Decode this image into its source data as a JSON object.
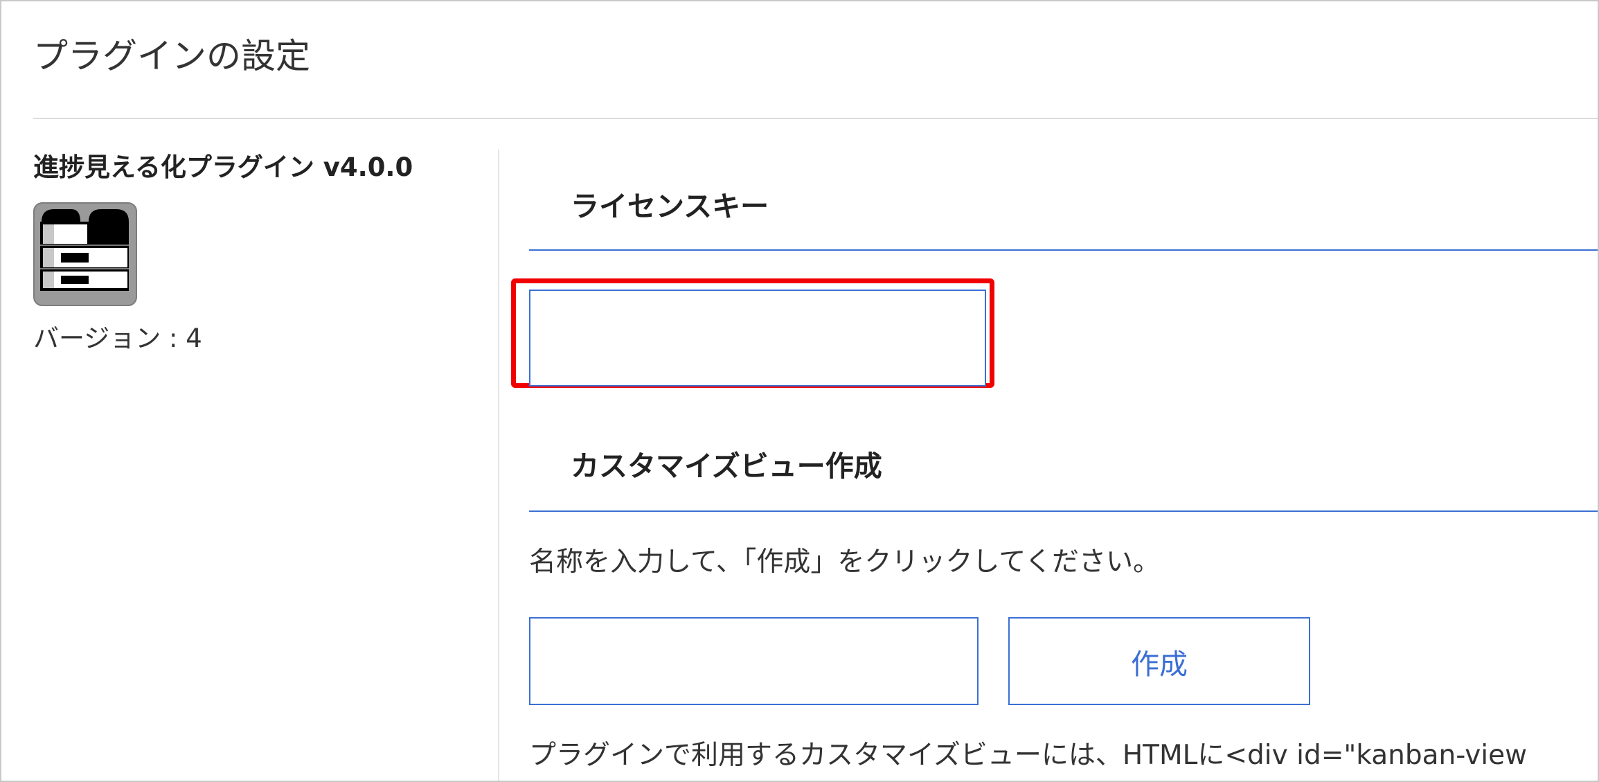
{
  "page": {
    "title": "プラグインの設定"
  },
  "plugin": {
    "name": "進捗見える化プラグイン v4.0.0",
    "icon": "kanban-progress-plugin-icon",
    "version": "バージョン : 4"
  },
  "license": {
    "heading": "ライセンスキー",
    "value": "",
    "placeholder": ""
  },
  "custom_view": {
    "heading": "カスタマイズビュー作成",
    "instruction": "名称を入力して、「作成」をクリックしてください。",
    "name_value": "",
    "name_placeholder": "",
    "create_label": "作成",
    "note": "プラグインで利用するカスタマイズビューには、HTMLに<div id=\"kanban-view"
  },
  "colors": {
    "accent": "#3b6fd4",
    "highlight": "#f10000",
    "text": "#333333",
    "divider": "#dcdcdc"
  }
}
